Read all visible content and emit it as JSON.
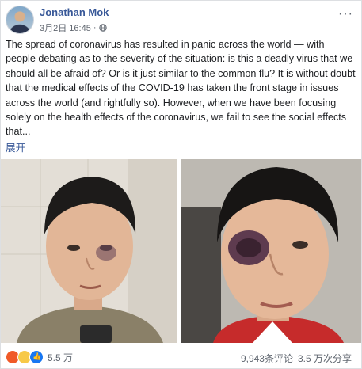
{
  "post": {
    "author": "Jonathan Mok",
    "date": "3月2日 16:45",
    "separator": "·",
    "text": "The spread of coronavirus has resulted in panic across the world — with people debating as to the severity of the situation: is this a deadly virus that we should all be afraid of? Or is it just similar to the common flu? It is without doubt that the medical effects of the COVID-19 has taken the front stage in issues across the world (and rightfully so). However, when we have been focusing solely on the health effects of the coronavirus, we fail to see the social effects that...",
    "expand_label": "展开",
    "more_icon": "···"
  },
  "footer": {
    "reaction_icons": [
      "angry-icon",
      "sad-icon",
      "like-icon"
    ],
    "reaction_count": "5.5 万",
    "comments": "9,943条评论",
    "shares": "3.5 万次分享"
  },
  "colors": {
    "name": "#385898",
    "muted": "#606770",
    "like": "#1877f2",
    "angry": "#f05a28",
    "sad": "#f7c948"
  }
}
